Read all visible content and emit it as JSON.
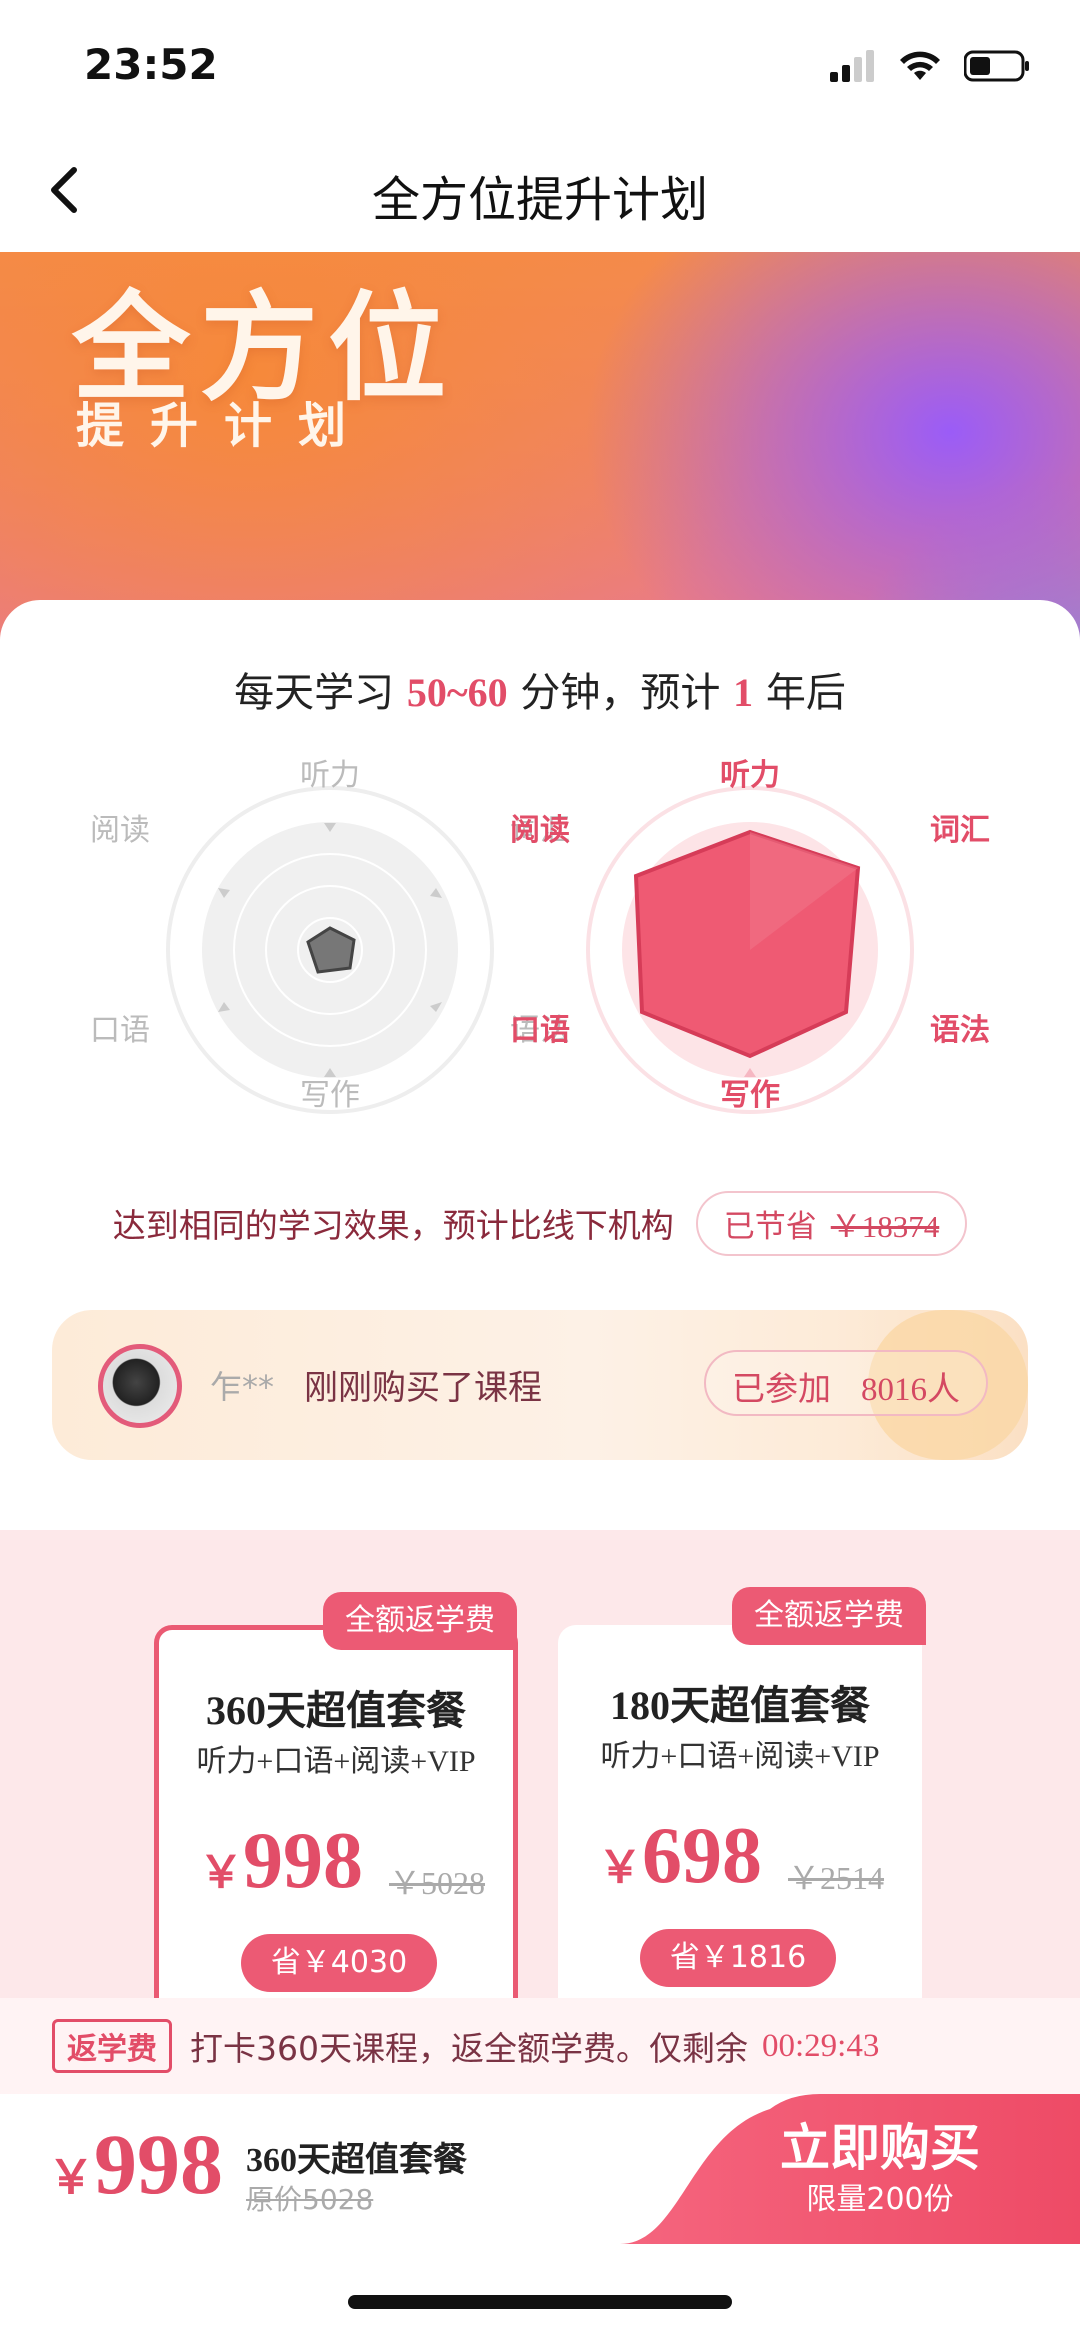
{
  "status_bar": {
    "time": "23:52"
  },
  "nav": {
    "title": "全方位提升计划"
  },
  "hero": {
    "title": "全方位",
    "subtitle": "提升计划"
  },
  "plan": {
    "prefix": "每天学习 ",
    "minutes": "50~60",
    "middle": " 分钟，预计 ",
    "years": "1",
    "suffix": " 年后"
  },
  "radar": {
    "before": {
      "labels": {
        "top": "听力",
        "top_left": "阅读",
        "top_right": "词汇",
        "bottom_left": "口语",
        "bottom_right": "语法",
        "bottom": "写作"
      },
      "fill_color": "#777777"
    },
    "after": {
      "labels": {
        "top": "听力",
        "top_left": "阅读",
        "top_right": "词汇",
        "bottom_left": "口语",
        "bottom_right": "语法",
        "bottom": "写作"
      },
      "fill_color": "#ef5a73"
    }
  },
  "savings": {
    "text": "达到相同的学习效果，预计比线下机构",
    "badge_label": "已节省",
    "amount": "￥18374"
  },
  "recent_purchase": {
    "buyer": "乍**",
    "action": "刚刚购买了课程",
    "joined_label": "已参加",
    "joined_count": "8016人"
  },
  "packages": [
    {
      "tag": "全额返学费",
      "name": "360天超值套餐",
      "features": "听力+口语+阅读+VIP",
      "currency": "￥",
      "price": "998",
      "original": "￥5028",
      "save": "省￥4030",
      "selected": true
    },
    {
      "tag": "全额返学费",
      "name": "180天超值套餐",
      "features": "听力+口语+阅读+VIP",
      "currency": "￥",
      "price": "698",
      "original": "￥2514",
      "save": "省￥1816",
      "selected": false
    }
  ],
  "refund": {
    "tag": "返学费",
    "text": "打卡360天课程，返全额学费。仅剩余",
    "timer": "00:29:43"
  },
  "buy_bar": {
    "currency": "￥",
    "price": "998",
    "package": "360天超值套餐",
    "original": "原价5028",
    "button_label": "立即购买",
    "limit": "限量200份"
  },
  "colors": {
    "accent": "#e24d68",
    "accent_bg": "#fde8ea"
  }
}
